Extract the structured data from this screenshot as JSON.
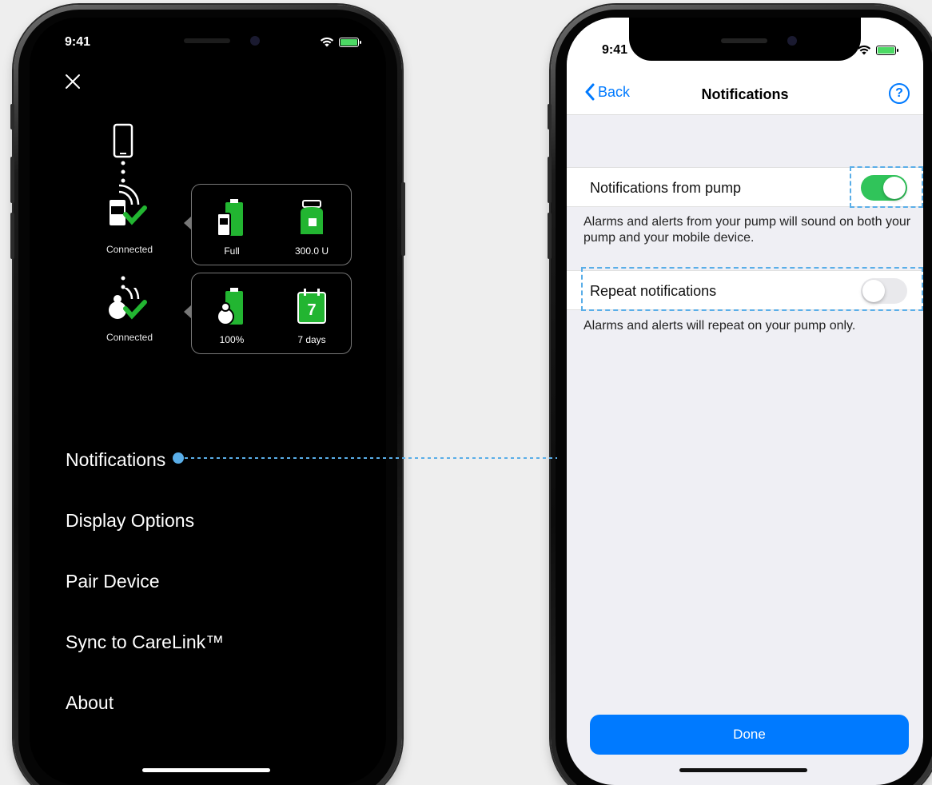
{
  "left_phone": {
    "status_time": "9:41",
    "close_icon": "close-icon",
    "devices": [
      {
        "status": "Connected",
        "items": [
          {
            "icon": "battery-icon",
            "label": "Full"
          },
          {
            "icon": "insulin-reservoir-icon",
            "label": "300.0 U"
          }
        ]
      },
      {
        "status": "Connected",
        "items": [
          {
            "icon": "sensor-battery-icon",
            "label": "100%"
          },
          {
            "icon": "calendar-icon",
            "label": "7 days",
            "badge": "7"
          }
        ]
      }
    ],
    "menu": [
      {
        "label": "Notifications"
      },
      {
        "label": "Display Options"
      },
      {
        "label": "Pair Device"
      },
      {
        "label": "Sync to CareLink™"
      },
      {
        "label": "About"
      }
    ]
  },
  "right_phone": {
    "status_time": "9:41",
    "nav": {
      "back_label": "Back",
      "title": "Notifications",
      "help_label": "?"
    },
    "settings": [
      {
        "label": "Notifications from pump",
        "enabled": true,
        "description": "Alarms and alerts from your pump will sound on both your pump and your mobile device."
      },
      {
        "label": "Repeat notifications",
        "enabled": false,
        "description": "Alarms and alerts will repeat on your pump only."
      }
    ],
    "done_label": "Done"
  },
  "colors": {
    "accent_blue": "#007aff",
    "toggle_on": "#30c45a",
    "status_green": "#22b531",
    "annotation": "#5aaee8"
  }
}
